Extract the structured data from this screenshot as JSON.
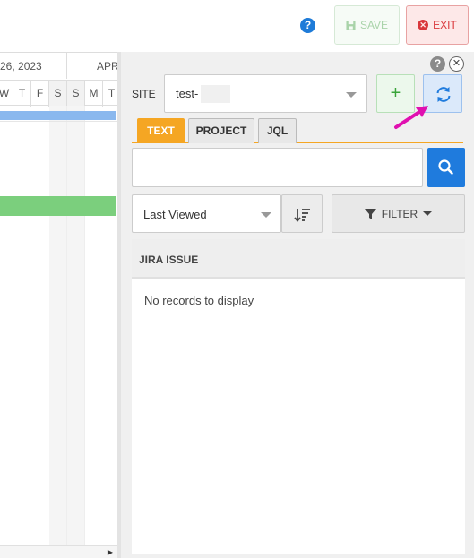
{
  "toolbar": {
    "help_icon": "question-circle-icon",
    "save_label": "SAVE",
    "exit_label": "EXIT",
    "save_icon": "floppy-disk-icon",
    "exit_icon": "x-circle-icon"
  },
  "gantt": {
    "month_left": "26, 2023",
    "month_right": "APR",
    "days": [
      "W",
      "T",
      "F",
      "S",
      "S",
      "M",
      "T"
    ],
    "bar_colors": {
      "blue": "#8ab8ee",
      "green": "#7bcf7d"
    }
  },
  "panel": {
    "site_label": "SITE",
    "site_value": "test-",
    "tabs": [
      {
        "label": "TEXT",
        "active": true
      },
      {
        "label": "PROJECT",
        "active": false
      },
      {
        "label": "JQL",
        "active": false
      }
    ],
    "search": {
      "value": "",
      "placeholder": ""
    },
    "sort_value": "Last Viewed",
    "filter_label": "FILTER",
    "table_header": "JIRA ISSUE",
    "empty_message": "No records to display"
  },
  "colors": {
    "accent_orange": "#f5a623",
    "primary_blue": "#1f7bdd",
    "exit_red": "#d9373b",
    "add_green": "#3aa43a",
    "annotation_magenta": "#e010b0"
  }
}
